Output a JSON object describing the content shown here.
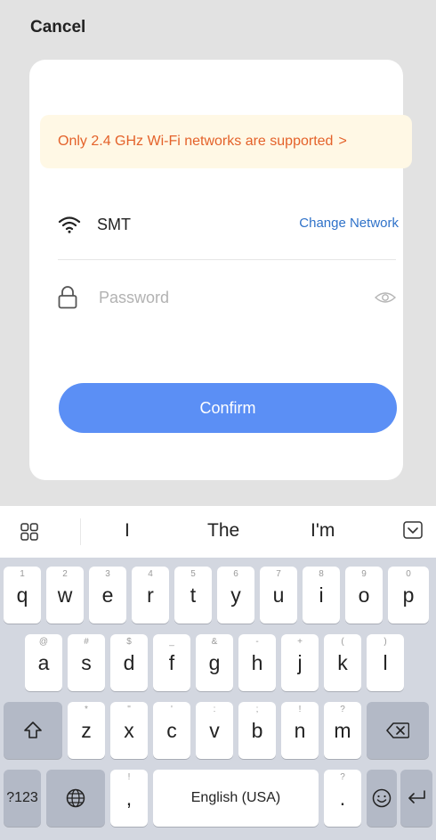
{
  "header": {
    "cancel_label": "Cancel"
  },
  "notice": {
    "text": "Only 2.4 GHz Wi-Fi networks are supported",
    "chevron": ">"
  },
  "network": {
    "ssid": "SMT",
    "change_label": "Change Network"
  },
  "password": {
    "placeholder": "Password",
    "value": ""
  },
  "confirm_label": "Confirm",
  "colors": {
    "accent": "#5b8ff5",
    "link": "#2f72c9",
    "warning_text": "#e4622a",
    "warning_bg": "#fff8e5"
  },
  "suggestions": [
    "I",
    "The",
    "I'm"
  ],
  "keyboard": {
    "row1": [
      {
        "main": "q",
        "hint": "1"
      },
      {
        "main": "w",
        "hint": "2"
      },
      {
        "main": "e",
        "hint": "3"
      },
      {
        "main": "r",
        "hint": "4"
      },
      {
        "main": "t",
        "hint": "5"
      },
      {
        "main": "y",
        "hint": "6"
      },
      {
        "main": "u",
        "hint": "7"
      },
      {
        "main": "i",
        "hint": "8"
      },
      {
        "main": "o",
        "hint": "9"
      },
      {
        "main": "p",
        "hint": "0"
      }
    ],
    "row2": [
      {
        "main": "a",
        "hint": "@"
      },
      {
        "main": "s",
        "hint": "#"
      },
      {
        "main": "d",
        "hint": "$"
      },
      {
        "main": "f",
        "hint": "_"
      },
      {
        "main": "g",
        "hint": "&"
      },
      {
        "main": "h",
        "hint": "-"
      },
      {
        "main": "j",
        "hint": "+"
      },
      {
        "main": "k",
        "hint": "("
      },
      {
        "main": "l",
        "hint": ")"
      }
    ],
    "row3": [
      {
        "main": "z",
        "hint": "*"
      },
      {
        "main": "x",
        "hint": "\""
      },
      {
        "main": "c",
        "hint": "'"
      },
      {
        "main": "v",
        "hint": ":"
      },
      {
        "main": "b",
        "hint": ";"
      },
      {
        "main": "n",
        "hint": "!"
      },
      {
        "main": "m",
        "hint": "?"
      }
    ],
    "symbols_label": "?123",
    "comma": {
      "main": ",",
      "hint": "!"
    },
    "space_label": "English (USA)",
    "period": {
      "main": ".",
      "hint": "?"
    },
    "icons": [
      "shift-icon",
      "backspace-icon",
      "globe-icon",
      "emoji-icon",
      "enter-icon",
      "grid-icon",
      "hide-keyboard-icon",
      "wifi-icon",
      "lock-icon",
      "eye-icon"
    ]
  }
}
